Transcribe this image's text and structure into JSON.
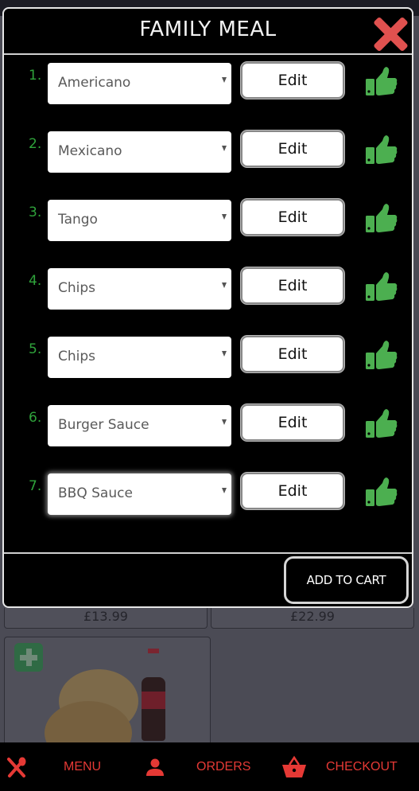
{
  "modal": {
    "title": "FAMILY MEAL",
    "close_icon": "close-icon",
    "items": [
      {
        "number": "1.",
        "selected": "Americano",
        "edit_label": "Edit",
        "status_icon": "thumbs-up-icon"
      },
      {
        "number": "2.",
        "selected": "Mexicano",
        "edit_label": "Edit",
        "status_icon": "thumbs-up-icon"
      },
      {
        "number": "3.",
        "selected": "Tango",
        "edit_label": "Edit",
        "status_icon": "thumbs-up-icon"
      },
      {
        "number": "4.",
        "selected": "Chips",
        "edit_label": "Edit",
        "status_icon": "thumbs-up-icon"
      },
      {
        "number": "5.",
        "selected": "Chips",
        "edit_label": "Edit",
        "status_icon": "thumbs-up-icon"
      },
      {
        "number": "6.",
        "selected": "Burger Sauce",
        "edit_label": "Edit",
        "status_icon": "thumbs-up-icon"
      },
      {
        "number": "7.",
        "selected": "BBQ Sauce",
        "edit_label": "Edit",
        "status_icon": "thumbs-up-icon"
      }
    ],
    "add_to_cart_label": "ADD TO CART"
  },
  "background": {
    "prices": [
      "£13.99",
      "£22.99"
    ]
  },
  "navbar": {
    "items": [
      {
        "label": "MENU",
        "icon": "cutlery-icon"
      },
      {
        "label": "ORDERS",
        "icon": "user-icon"
      },
      {
        "label": "CHECKOUT",
        "icon": "basket-icon"
      }
    ]
  },
  "colors": {
    "accent_green": "#2fa33b",
    "thumb_green": "#4caf50",
    "close_red": "#e0514f",
    "nav_red": "#e53935"
  }
}
